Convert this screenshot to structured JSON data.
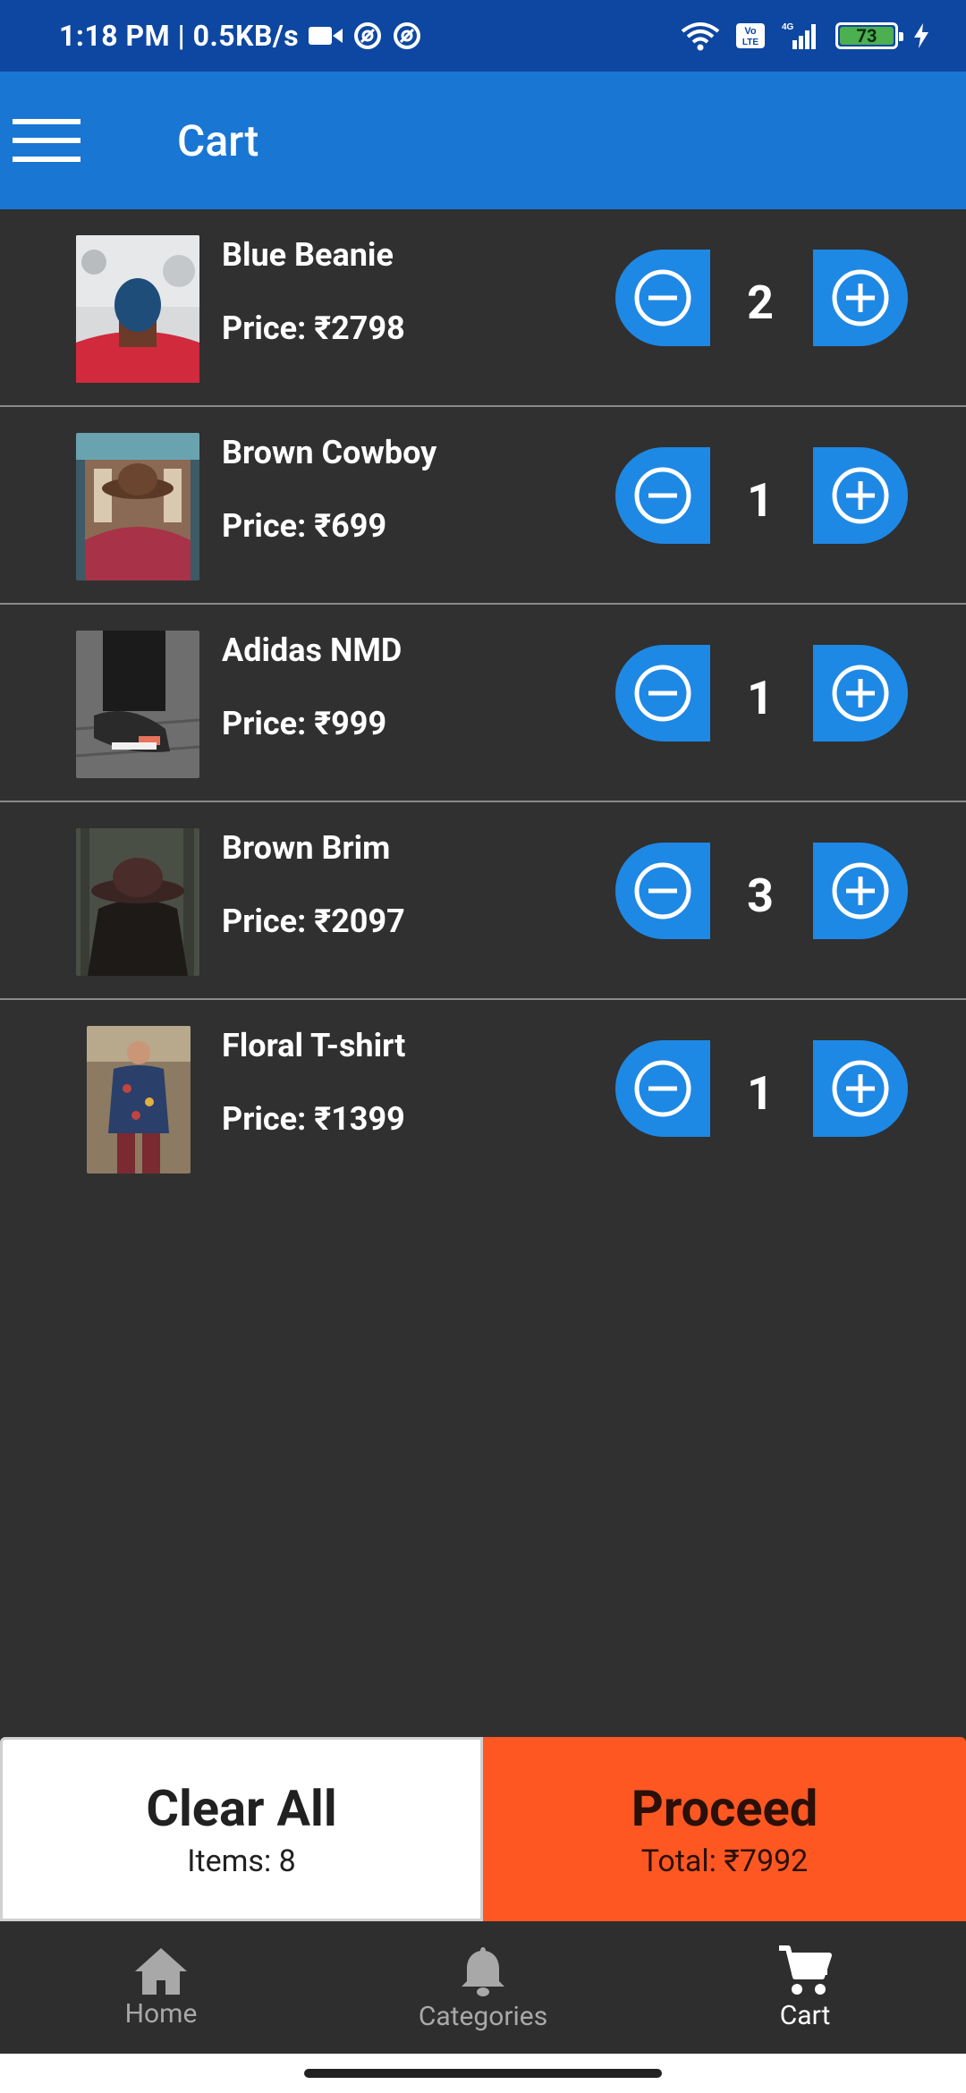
{
  "status_bar": {
    "time_speed": "1:18 PM | 0.5KB/s",
    "network_label": "4G",
    "volte_label": "Vo LTE",
    "battery_level": "73"
  },
  "app_bar": {
    "title": "Cart"
  },
  "cart": {
    "items": [
      {
        "name": "Blue Beanie",
        "price": "Price:  ₹2798",
        "quantity": "2"
      },
      {
        "name": "Brown Cowboy",
        "price": "Price:  ₹699",
        "quantity": "1"
      },
      {
        "name": "Adidas NMD",
        "price": "Price:  ₹999",
        "quantity": "1"
      },
      {
        "name": "Brown Brim",
        "price": "Price:  ₹2097",
        "quantity": "3"
      },
      {
        "name": "Floral T-shirt",
        "price": "Price:  ₹1399",
        "quantity": "1"
      }
    ]
  },
  "actions": {
    "clear_label": "Clear All",
    "items_count": "Items: 8",
    "proceed_label": "Proceed",
    "total": "Total: ₹7992"
  },
  "bottom_nav": {
    "items": [
      {
        "label": "Home",
        "icon": "home-icon"
      },
      {
        "label": "Categories",
        "icon": "bell-icon"
      },
      {
        "label": "Cart",
        "icon": "cart-icon"
      }
    ],
    "active": "Cart"
  },
  "colors": {
    "status_bar": "#0d47a1",
    "app_bar": "#1976d2",
    "background": "#303030",
    "qty_button": "#1e88e5",
    "proceed": "#ff5722",
    "clear": "#ffffff"
  }
}
